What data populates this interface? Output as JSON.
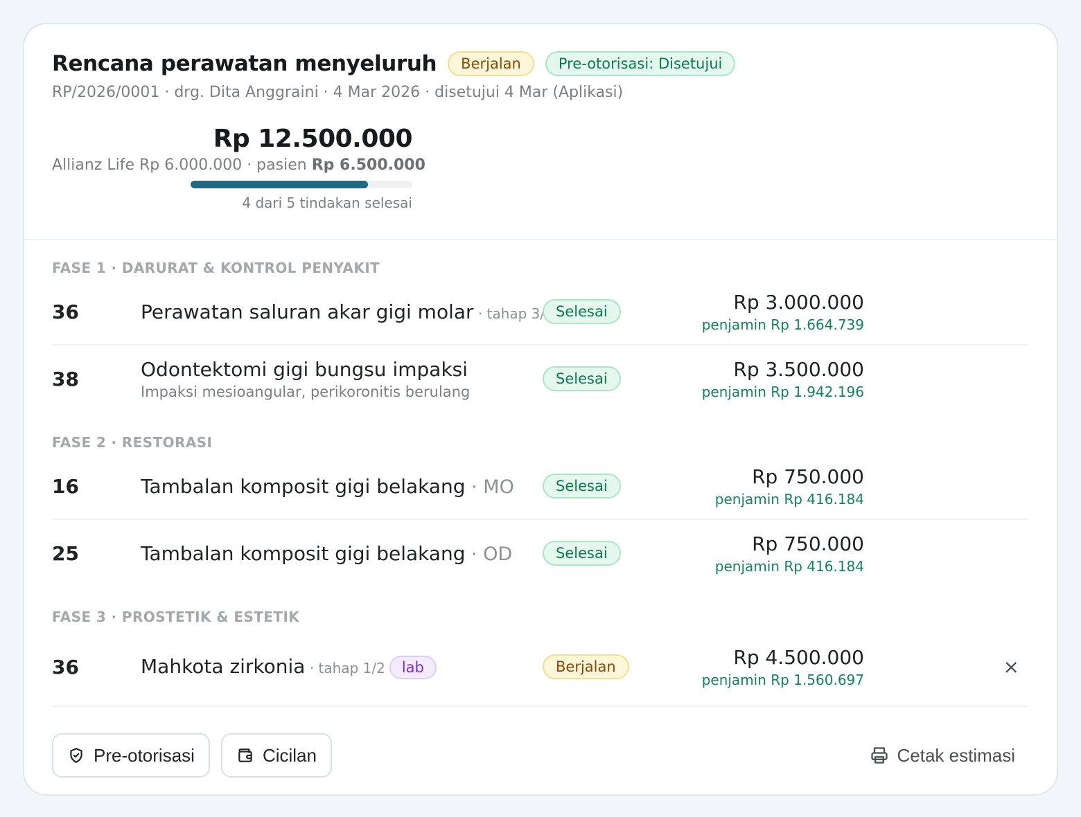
{
  "plan": {
    "title": "Rencana perawatan menyeluruh",
    "status_badge": "Berjalan",
    "preauth_badge": "Pre-otorisasi: Disetujui",
    "meta": "RP/2026/0001 · drg. Dita Anggraini · 4 Mar 2026 · disetujui 4 Mar (Aplikasi)",
    "total": "Rp 12.500.000",
    "insurer_part": "Allianz Life Rp 6.000.000 · pasien ",
    "patient_part": "Rp 6.500.000",
    "progress_fraction": 0.8,
    "progress_label": "4 dari 5 tindakan selesai"
  },
  "phases": [
    {
      "title": "FASE 1 · DARURAT & KONTROL PENYAKIT",
      "items": [
        {
          "tooth": "36",
          "name": "Perawatan saluran akar gigi molar",
          "detail": " · tahap 3/3",
          "note": "",
          "status": "Selesai",
          "price": "Rp 3.000.000",
          "insurer": "penjamin Rp 1.664.739"
        },
        {
          "tooth": "38",
          "name": "Odontektomi gigi bungsu impaksi",
          "detail": "",
          "note": "Impaksi mesioangular, perikoronitis berulang",
          "status": "Selesai",
          "price": "Rp 3.500.000",
          "insurer": "penjamin Rp 1.942.196"
        }
      ]
    },
    {
      "title": "FASE 2 · RESTORASI",
      "items": [
        {
          "tooth": "16",
          "name": "Tambalan komposit gigi belakang",
          "detail": " · MO",
          "note": "",
          "status": "Selesai",
          "price": "Rp 750.000",
          "insurer": "penjamin Rp 416.184"
        },
        {
          "tooth": "25",
          "name": "Tambalan komposit gigi belakang",
          "detail": " · OD",
          "note": "",
          "status": "Selesai",
          "price": "Rp 750.000",
          "insurer": "penjamin Rp 416.184"
        }
      ]
    },
    {
      "title": "FASE 3 · PROSTETIK & ESTETIK",
      "items": [
        {
          "tooth": "36",
          "name": "Mahkota zirkonia",
          "detail": " · tahap 1/2",
          "tag": "lab",
          "note": "",
          "status": "Berjalan",
          "price": "Rp 4.500.000",
          "insurer": "penjamin Rp 1.560.697",
          "remove": "×"
        }
      ]
    }
  ],
  "footer": {
    "preauth_button": "Pre-otorisasi",
    "installment_button": "Cicilan",
    "print_button": "Cetak estimasi"
  },
  "colors": {
    "accent": "#1c6a86",
    "done": "#0d7a4e",
    "in_progress": "#8a4a06",
    "lab": "#7b2ed6"
  },
  "icons": [
    "shield-check-icon",
    "wallet-icon",
    "printer-icon",
    "close-icon"
  ]
}
